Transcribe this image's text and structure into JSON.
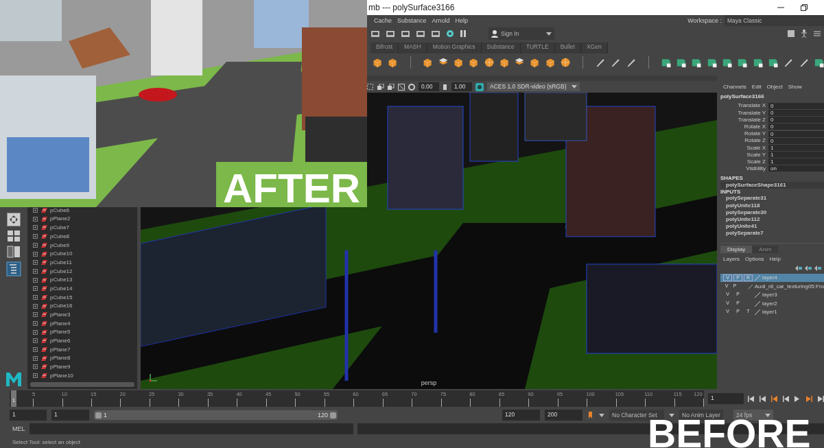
{
  "title_bar": {
    "title": "mb  ---  polySurface3166"
  },
  "menu": [
    "Cache",
    "Substance",
    "Arnold",
    "Help"
  ],
  "workspace": {
    "label": "Workspace :",
    "value": "Maya Classic"
  },
  "sign_in": {
    "label": "Sign In"
  },
  "shelf_tabs": [
    "Bifrost",
    "MASH",
    "Motion Graphics",
    "Substance",
    "TURTLE",
    "Bullet",
    "XGen"
  ],
  "viewport": {
    "exposure": "0.00",
    "gamma": "1.00",
    "color_space": "ACES 1.0 SDR-video (sRGB)",
    "camera": "persp"
  },
  "channel_box": {
    "menu": [
      "Channels",
      "Edit",
      "Object",
      "Show"
    ],
    "object": "polySurface3166",
    "channels": [
      {
        "name": "Translate X",
        "value": "0"
      },
      {
        "name": "Translate Y",
        "value": "0"
      },
      {
        "name": "Translate Z",
        "value": "0"
      },
      {
        "name": "Rotate X",
        "value": "0"
      },
      {
        "name": "Rotate Y",
        "value": "0"
      },
      {
        "name": "Rotate Z",
        "value": "0"
      },
      {
        "name": "Scale X",
        "value": "1"
      },
      {
        "name": "Scale Y",
        "value": "1"
      },
      {
        "name": "Scale Z",
        "value": "1"
      },
      {
        "name": "Visibility",
        "value": "on"
      }
    ],
    "shapes_heading": "SHAPES",
    "shapes": [
      "polySurfaceShape3161"
    ],
    "inputs_heading": "INPUTS",
    "inputs": [
      "polySeparate31",
      "polyUnite118",
      "polySeparate30",
      "polyUnite112",
      "polyUnite41",
      "polySeparate7"
    ]
  },
  "layer_editor": {
    "tabs": [
      {
        "label": "Display",
        "selected": true
      },
      {
        "label": "Anim",
        "selected": false
      }
    ],
    "menu": [
      "Layers",
      "Options",
      "Help"
    ],
    "layers": [
      {
        "name": "layer4",
        "selected": true,
        "flags": [
          "V",
          "P",
          "R"
        ]
      },
      {
        "name": "Audi_r8_car_texturing05:Fro",
        "selected": false,
        "flags": [
          "V",
          "P"
        ]
      },
      {
        "name": "layer3",
        "selected": false,
        "flags": [
          "V",
          "P"
        ]
      },
      {
        "name": "layer2",
        "selected": false,
        "flags": [
          "V",
          "P"
        ]
      },
      {
        "name": "layer1",
        "selected": false,
        "flags": [
          "V",
          "P",
          "T"
        ]
      }
    ]
  },
  "outliner": {
    "items": [
      "pCube6",
      "pPlane2",
      "pCube7",
      "pCube8",
      "pCube9",
      "pCube10",
      "pCube11",
      "pCube12",
      "pCube13",
      "pCube14",
      "pCube15",
      "pCube16",
      "pPlane3",
      "pPlane4",
      "pPlane5",
      "pPlane6",
      "pPlane7",
      "pPlane8",
      "pPlane9",
      "pPlane10"
    ]
  },
  "timeline": {
    "current": "1",
    "ticks": [
      "5",
      "10",
      "15",
      "20",
      "25",
      "30",
      "35",
      "40",
      "45",
      "50",
      "55",
      "60",
      "65",
      "70",
      "75",
      "80",
      "85",
      "90",
      "95",
      "100",
      "105",
      "110",
      "115",
      "120"
    ],
    "current_frame": "1"
  },
  "range": {
    "start": "1",
    "playback_start": "1",
    "slider_start": "1",
    "slider_end": "120",
    "level": 1,
    "playback_end": "120",
    "end": "200",
    "character_set": "No Character Set",
    "anim_layer": "No Anim Layer",
    "fps": "24 fps"
  },
  "command_line": {
    "label": "MEL"
  },
  "help_line": "Select Tool: select an object",
  "overlays": {
    "after": "AFTER",
    "before": "BEFORE"
  }
}
